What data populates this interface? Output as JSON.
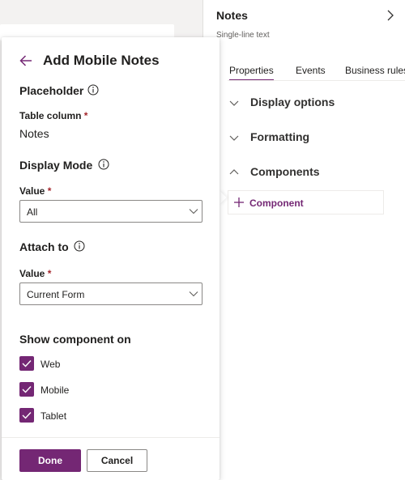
{
  "right_pane": {
    "title": "Notes",
    "subtitle": "Single-line text",
    "tabs": [
      {
        "label": "Properties",
        "active": true
      },
      {
        "label": "Events",
        "active": false
      },
      {
        "label": "Business rules",
        "active": false
      }
    ],
    "sections": [
      {
        "label": "Display options",
        "expanded": false
      },
      {
        "label": "Formatting",
        "expanded": false
      },
      {
        "label": "Components",
        "expanded": true
      }
    ],
    "add_component_label": "Component"
  },
  "flyout": {
    "title": "Add Mobile Notes",
    "placeholder_label": "Placeholder",
    "table_column": {
      "label": "Table column",
      "required": "*",
      "value": "Notes"
    },
    "display_mode": {
      "label": "Display Mode",
      "value_label": "Value",
      "required": "*",
      "selected": "All"
    },
    "attach_to": {
      "label": "Attach to",
      "value_label": "Value",
      "required": "*",
      "selected": "Current Form"
    },
    "show_on": {
      "label": "Show component on",
      "options": [
        {
          "label": "Web",
          "checked": true
        },
        {
          "label": "Mobile",
          "checked": true
        },
        {
          "label": "Tablet",
          "checked": true
        }
      ]
    },
    "done_label": "Done",
    "cancel_label": "Cancel"
  },
  "colors": {
    "accent": "#742774",
    "required": "#a4262c",
    "border": "#8a8886"
  },
  "icons": [
    "back-arrow-icon",
    "info-icon",
    "chevron-down-icon",
    "chevron-right-icon",
    "chevron-up-icon",
    "plus-icon",
    "checkmark-icon"
  ]
}
